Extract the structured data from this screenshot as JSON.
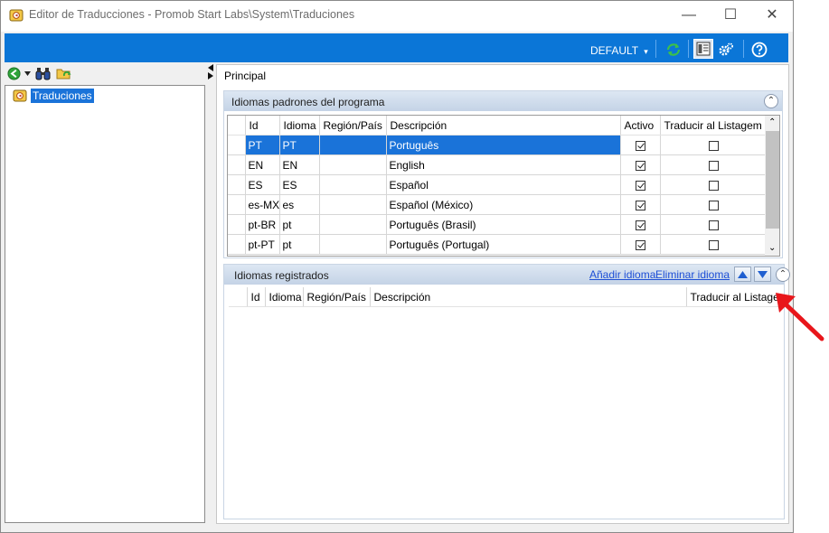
{
  "window": {
    "title": "Editor de Traducciones - Promob Start Labs\\System\\Traduciones",
    "minimize_glyph": "—",
    "maximize_glyph": "☐",
    "close_glyph": "✕"
  },
  "ribbon": {
    "profile_label": "DEFAULT",
    "profile_caret": "▾",
    "icons": [
      "refresh-icon",
      "layout-icon",
      "settings-icon",
      "help-icon"
    ],
    "accent_color": "#0b76d7"
  },
  "left_toolbar": {
    "icons": [
      "back-icon",
      "dropdown-caret-icon",
      "binoculars-icon",
      "folder-refresh-icon"
    ]
  },
  "tree": {
    "items": [
      {
        "label": "Traduciones",
        "selected": true
      }
    ]
  },
  "main": {
    "title": "Principal",
    "default_languages": {
      "title": "Idiomas padrones del programa",
      "columns": [
        "Id",
        "Idioma",
        "Región/País",
        "Descripción",
        "Activo",
        "Traducir al Listagem"
      ],
      "rows": [
        {
          "id": "PT",
          "idioma": "PT",
          "region": "",
          "descripcion": "Português",
          "activo": true,
          "traducir": false,
          "selected": true
        },
        {
          "id": "EN",
          "idioma": "EN",
          "region": "",
          "descripcion": "English",
          "activo": true,
          "traducir": false,
          "selected": false
        },
        {
          "id": "ES",
          "idioma": "ES",
          "region": "",
          "descripcion": "Español",
          "activo": true,
          "traducir": false,
          "selected": false
        },
        {
          "id": "es-MX",
          "idioma": "es",
          "region": "",
          "descripcion": "Español (México)",
          "activo": true,
          "traducir": false,
          "selected": false
        },
        {
          "id": "pt-BR",
          "idioma": "pt",
          "region": "",
          "descripcion": "Português (Brasil)",
          "activo": true,
          "traducir": false,
          "selected": false
        },
        {
          "id": "pt-PT",
          "idioma": "pt",
          "region": "",
          "descripcion": "Português (Portugal)",
          "activo": true,
          "traducir": false,
          "selected": false
        }
      ]
    },
    "registered_languages": {
      "title": "Idiomas registrados",
      "add_link": "Añadir idioma",
      "remove_link": "Eliminar idioma",
      "columns": [
        "Id",
        "Idioma",
        "Región/País",
        "Descripción",
        "Traducir al Listagem"
      ],
      "rows": []
    }
  },
  "annotation": {
    "color": "#e8161b"
  }
}
